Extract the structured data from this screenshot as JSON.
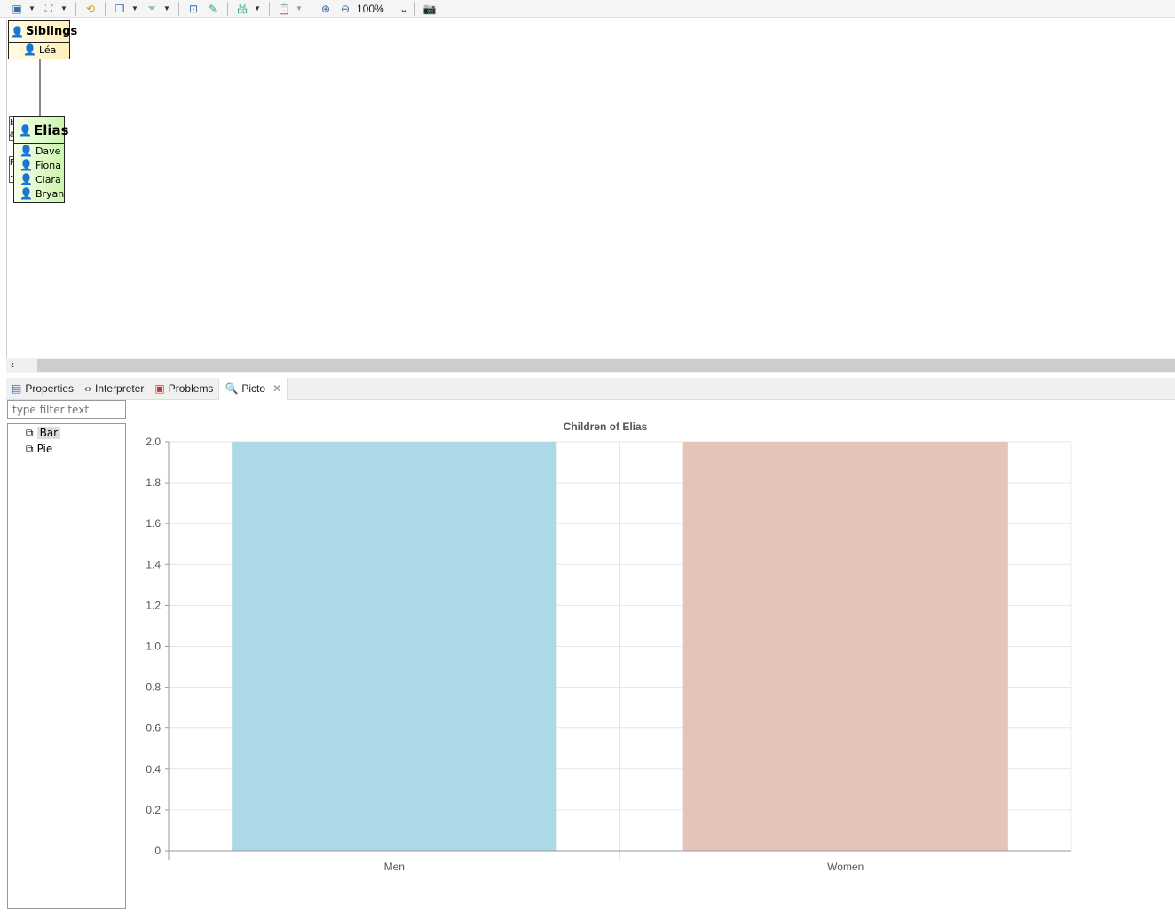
{
  "toolbar": {
    "zoom": "100%",
    "icons": [
      "layout-icon",
      "arrange-icon",
      "refresh-icon",
      "select-icon",
      "filter-icon",
      "export-icon",
      "edit-icon",
      "tree-layout-icon",
      "clipboard-icon",
      "zoom-in-icon",
      "zoom-out-icon",
      "camera-icon"
    ]
  },
  "diagram": {
    "siblings": {
      "title": "Siblings",
      "members": [
        "Léa"
      ]
    },
    "elias": {
      "title": "Elias",
      "members": [
        "Dave",
        "Fiona",
        "Clara",
        "Bryan"
      ],
      "side_labels": [
        "Is",
        "a",
        "P",
        "..."
      ]
    }
  },
  "tabs": [
    {
      "label": "Properties"
    },
    {
      "label": "Interpreter"
    },
    {
      "label": "Problems"
    },
    {
      "label": "Picto",
      "active": true
    }
  ],
  "filter": {
    "placeholder": "type filter text"
  },
  "tree": [
    {
      "label": "Bar",
      "selected": true
    },
    {
      "label": "Pie"
    }
  ],
  "chart_data": {
    "type": "bar",
    "title": "Children of Elias",
    "categories": [
      "Men",
      "Women"
    ],
    "values": [
      2,
      2
    ],
    "colors": [
      "#add8e6",
      "#e6c3b9"
    ],
    "ylim": [
      0,
      2.0
    ],
    "yticks": [
      "0",
      "0.2",
      "0.4",
      "0.6",
      "0.8",
      "1.0",
      "1.2",
      "1.4",
      "1.6",
      "1.8",
      "2.0"
    ],
    "grid": true
  }
}
